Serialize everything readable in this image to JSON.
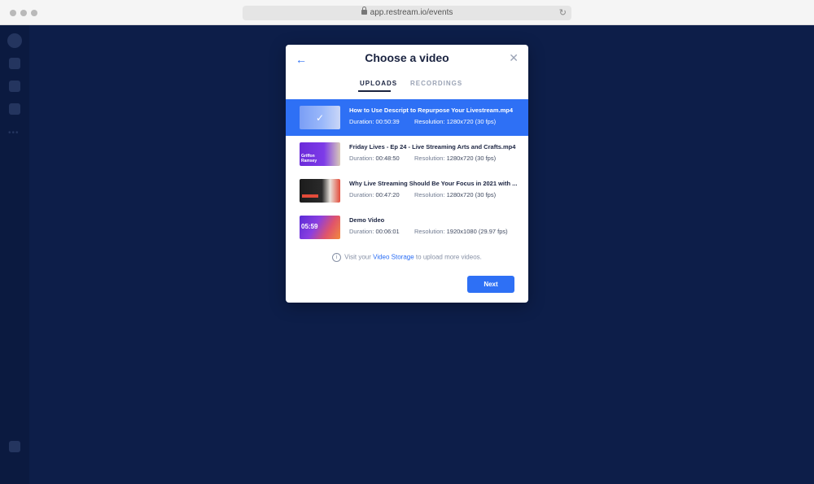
{
  "browser": {
    "url": "app.restream.io/events",
    "lock_icon": "lock-icon",
    "reload_icon": "reload-icon"
  },
  "modal": {
    "title": "Choose a video",
    "back_icon": "arrow-left-icon",
    "close_icon": "close-icon",
    "tabs": [
      {
        "label": "UPLOADS",
        "active": true
      },
      {
        "label": "RECORDINGS",
        "active": false
      }
    ],
    "videos": [
      {
        "name": "How to Use Descript to Repurpose Your Livestream.mp4",
        "duration_label": "Duration:",
        "duration": "00:50:39",
        "resolution_label": "Resolution:",
        "resolution": "1280x720 (30 fps)",
        "selected": true
      },
      {
        "name": "Friday Lives - Ep 24 - Live Streaming Arts and Crafts.mp4",
        "duration_label": "Duration:",
        "duration": "00:48:50",
        "resolution_label": "Resolution:",
        "resolution": "1280x720 (30 fps)",
        "selected": false,
        "thumb_text": "Griffon Ramsey"
      },
      {
        "name": "Why Live Streaming Should Be Your Focus in 2021 with ...",
        "duration_label": "Duration:",
        "duration": "00:47:20",
        "resolution_label": "Resolution:",
        "resolution": "1280x720 (30 fps)",
        "selected": false
      },
      {
        "name": "Demo Video",
        "duration_label": "Duration:",
        "duration": "00:06:01",
        "resolution_label": "Resolution:",
        "resolution": "1920x1080 (29.97 fps)",
        "selected": false,
        "thumb_text": "05:59"
      }
    ],
    "info": {
      "icon": "info-icon",
      "before": "Visit your",
      "link": "Video Storage",
      "after": "to upload more videos."
    },
    "next_label": "Next"
  },
  "colors": {
    "accent": "#2e70f5",
    "background": "#0d1e49",
    "title": "#1a2340"
  }
}
